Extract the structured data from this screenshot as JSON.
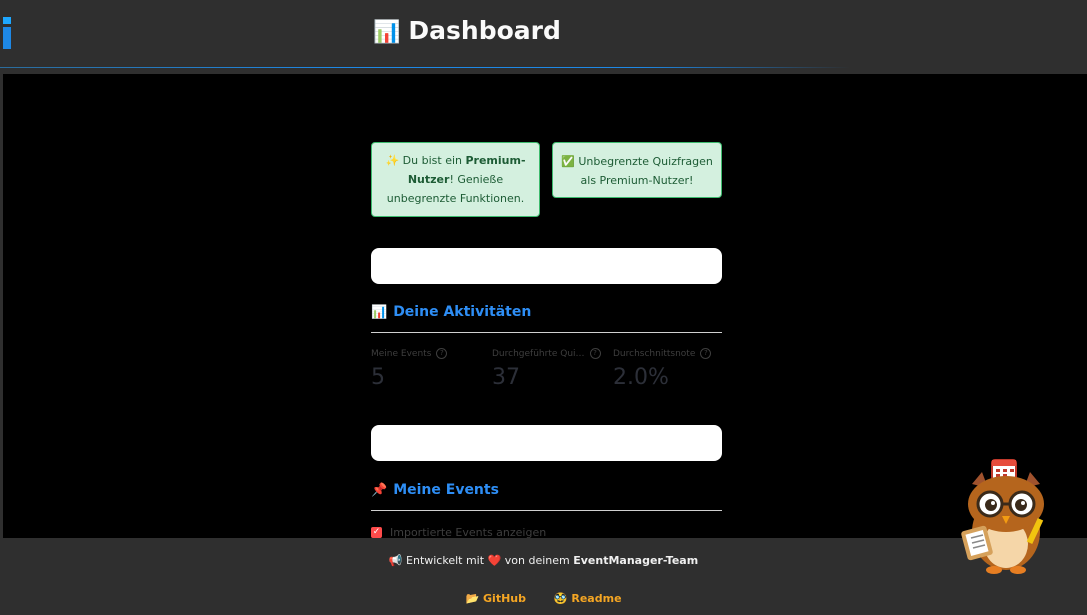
{
  "header": {
    "title": "Dashboard",
    "title_icon": "📊"
  },
  "notices": {
    "premium": {
      "icon": "✨",
      "prefix": "Du bist ein ",
      "strong": "Premium-Nutzer",
      "suffix": "! Genieße unbegrenzte Funktionen."
    },
    "quiz": {
      "icon": "✅",
      "text": "Unbegrenzte Quizfragen als Premium-Nutzer!"
    }
  },
  "activities": {
    "icon": "📊",
    "title": "Deine Aktivitäten",
    "metrics": [
      {
        "label": "Meine Events",
        "value": "5"
      },
      {
        "label": "Durchgeführte Qui…",
        "value": "37"
      },
      {
        "label": "Durchschnittsnote",
        "value": "2.0%"
      }
    ]
  },
  "events": {
    "icon": "📌",
    "title": "Meine Events",
    "checkbox_label": "Importierte Events anzeigen",
    "checkbox_checked": true
  },
  "footer": {
    "credit_icon": "📢",
    "credit_prefix": "Entwickelt mit",
    "heart": "❤️",
    "credit_middle": "von deinem",
    "credit_team": "EventManager-Team",
    "links": [
      {
        "icon": "📂",
        "label": "GitHub"
      },
      {
        "icon": "🥸",
        "label": "Readme"
      }
    ]
  },
  "colors": {
    "accent": "#2e8ef5",
    "notice_bg": "#d4f0df",
    "notice_border": "#3dbb6e",
    "link": "#f5a623",
    "checkbox": "#ff4b4b"
  }
}
